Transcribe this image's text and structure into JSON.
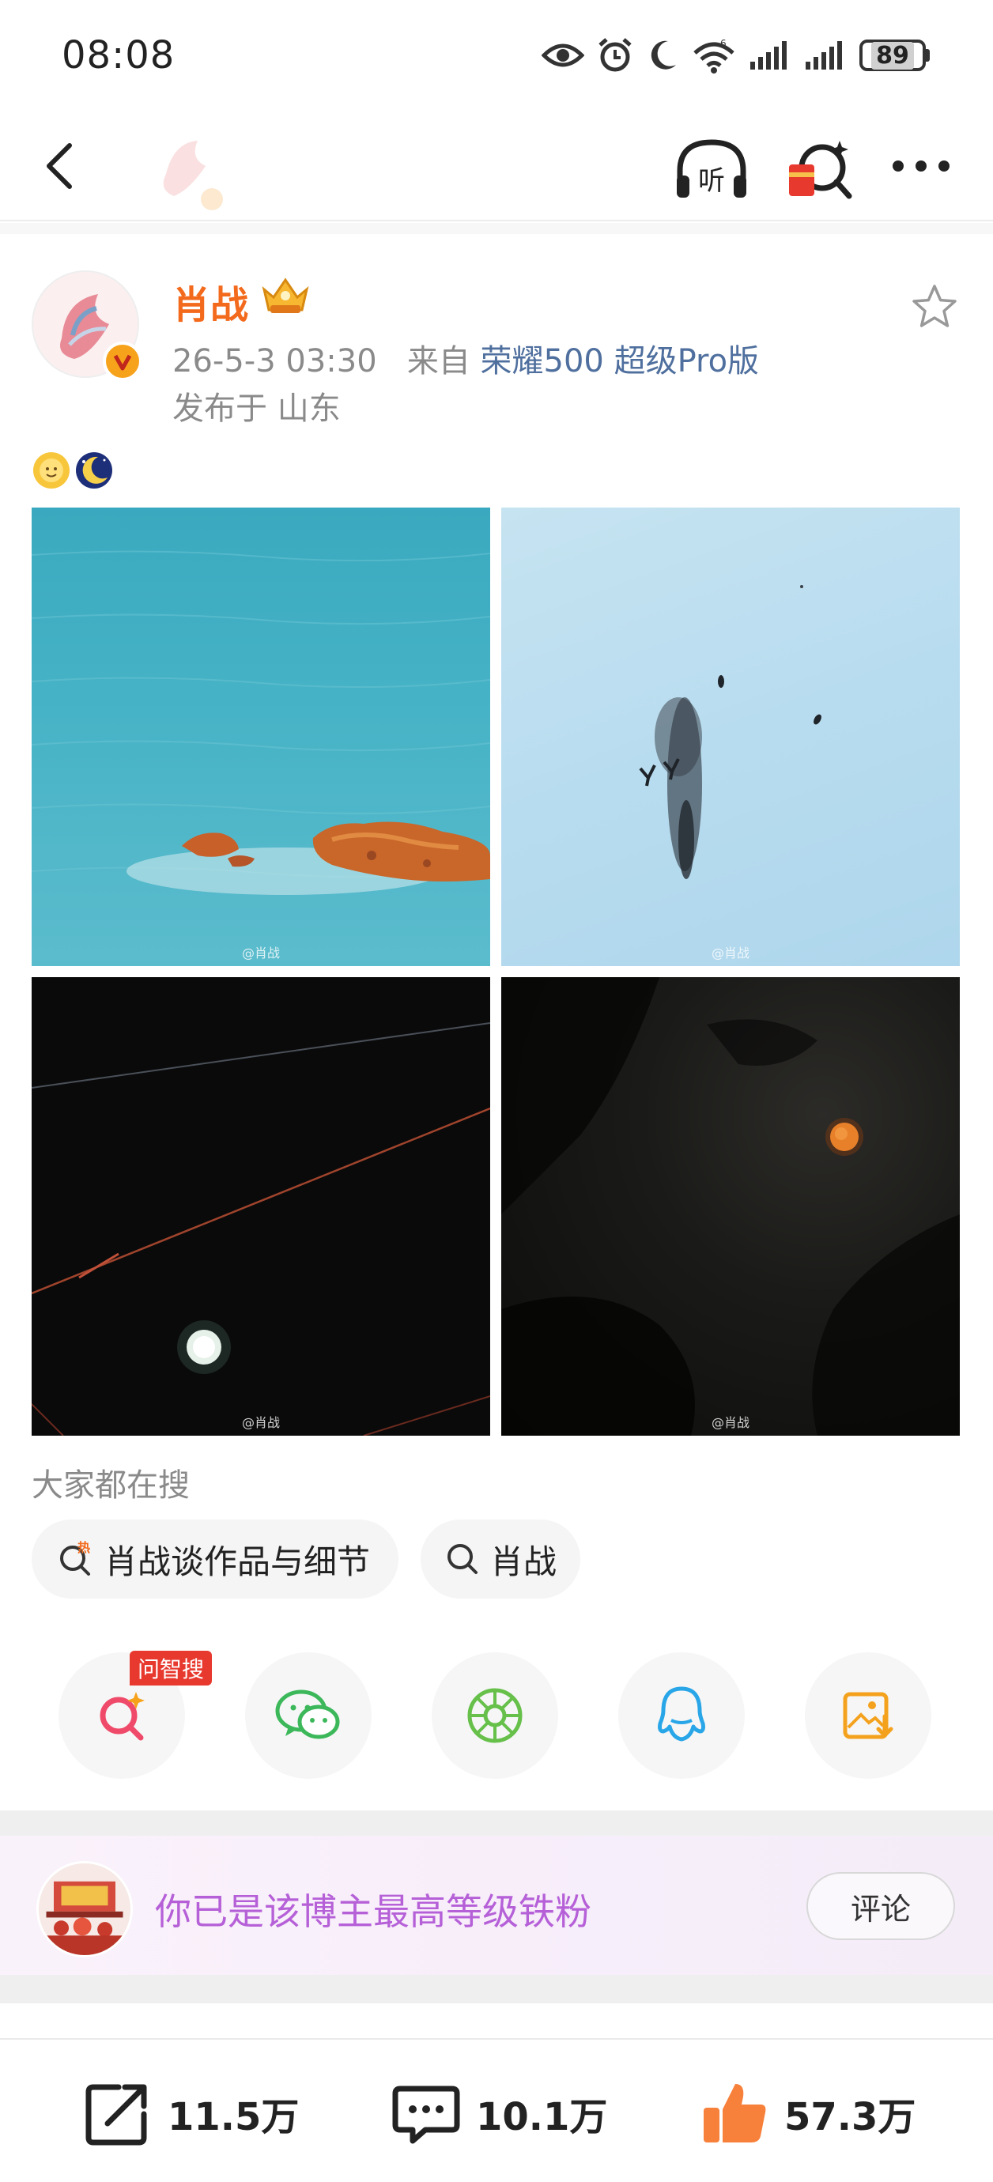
{
  "status_bar": {
    "time": "08:08",
    "battery": "89",
    "icons": [
      "eye-icon",
      "alarm-icon",
      "moon-icon",
      "wifi-icon",
      "signal-icon",
      "signal-icon"
    ]
  },
  "nav": {
    "icons": [
      "back-icon",
      "listen-icon",
      "red-packet-search-icon",
      "more-icon"
    ],
    "listen_glyph": "听"
  },
  "post": {
    "author": "肖战",
    "time": "26-5-3 03:30",
    "source_prefix": "来自",
    "source": "荣耀500 超级Pro版",
    "location": "发布于 山东",
    "emojis": [
      "sun-emoji",
      "moon-emoji"
    ],
    "image_watermarks": [
      "@肖战",
      "@肖战",
      "@肖战",
      "@肖战"
    ]
  },
  "hot_search": {
    "title": "大家都在搜",
    "chips": [
      {
        "label": "肖战谈作品与细节",
        "icon": "hot-search-icon",
        "badge": "热"
      },
      {
        "label": "肖战",
        "icon": "search-icon"
      }
    ]
  },
  "share": {
    "tag": "问智搜",
    "items": [
      "ai-search-icon",
      "wechat-icon",
      "moments-icon",
      "qq-icon",
      "save-image-icon"
    ]
  },
  "fan_bar": {
    "text": "你已是该博主最高等级铁粉",
    "button": "评论"
  },
  "actions": {
    "repost": "11.5万",
    "comment": "10.1万",
    "like": "57.3万"
  },
  "colors": {
    "name": "#f36a1d",
    "source": "#4f6f9e",
    "fan_text": "#b660d8",
    "like": "#f7803a"
  }
}
